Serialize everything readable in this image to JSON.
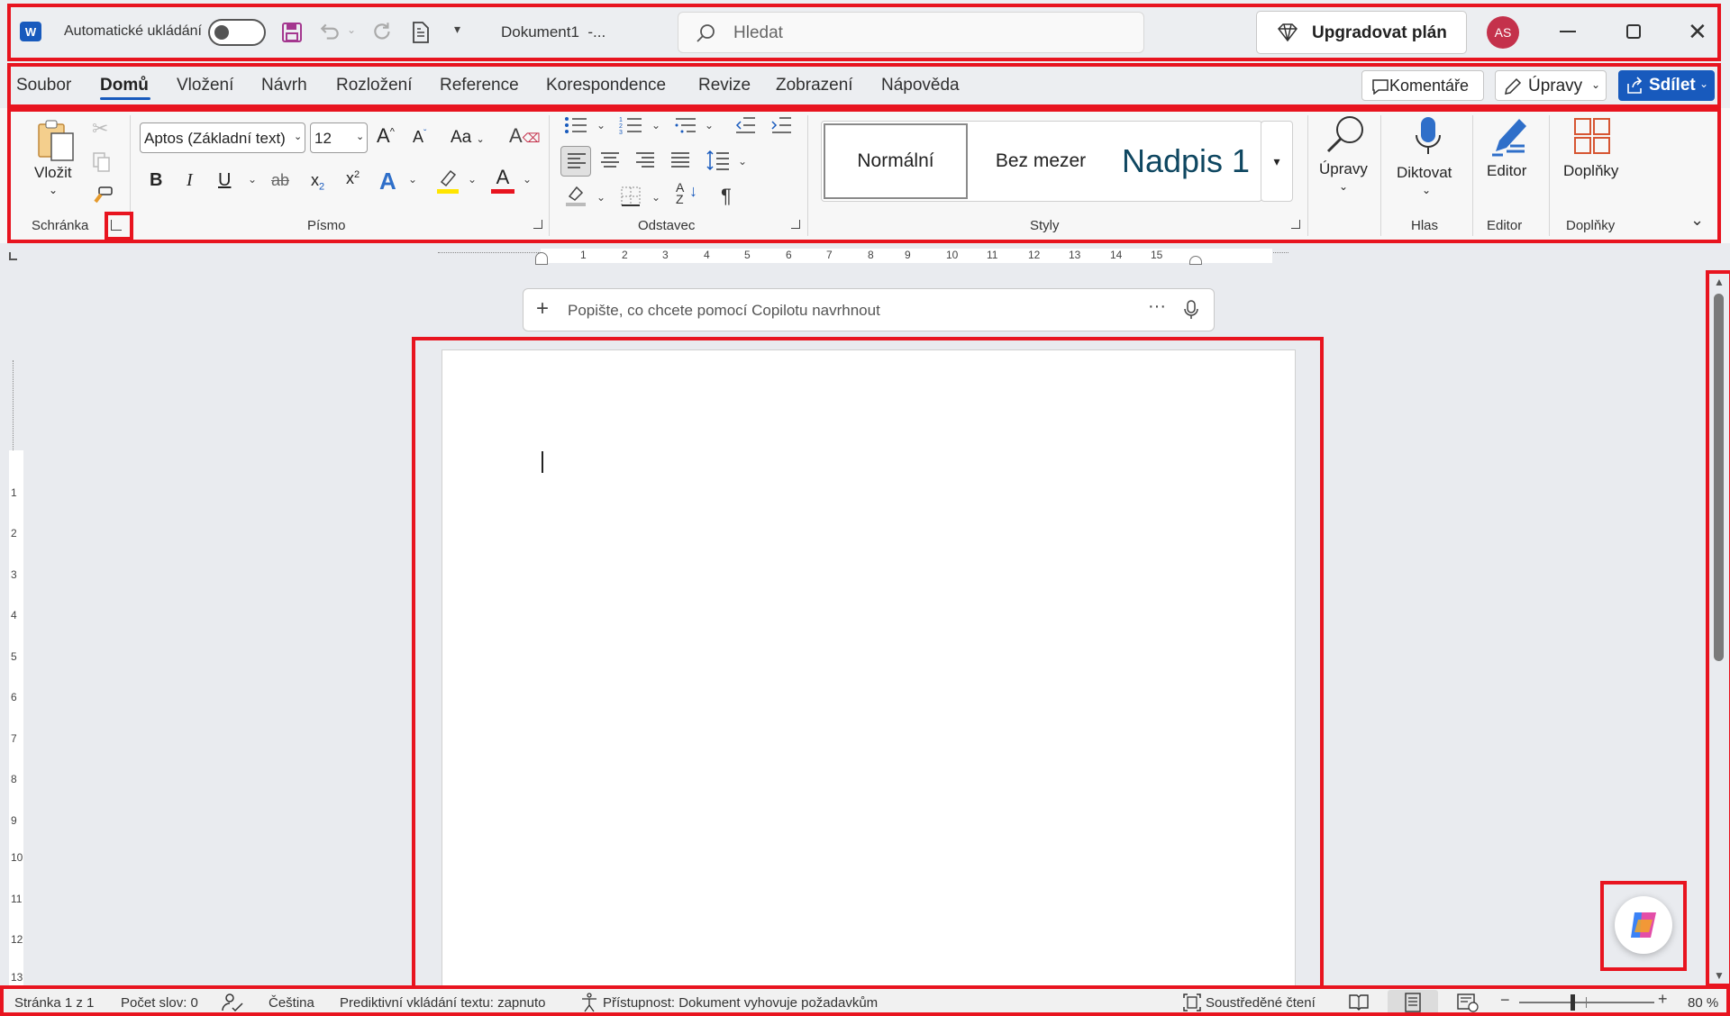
{
  "titlebar": {
    "autosave_label": "Automatické ukládání",
    "doc_name": "Dokument1  -...",
    "search_placeholder": "Hledat",
    "upgrade_label": "Upgradovat plán",
    "avatar_initials": "AS"
  },
  "tabs": [
    "Soubor",
    "Domů",
    "Vložení",
    "Návrh",
    "Rozložení",
    "Reference",
    "Korespondence",
    "Revize",
    "Zobrazení",
    "Nápověda"
  ],
  "tabbar_actions": {
    "comments": "Komentáře",
    "editing": "Úpravy",
    "share": "Sdílet"
  },
  "ribbon": {
    "paste_label": "Vložit",
    "font_name": "Aptos (Základní text)",
    "font_size": "12",
    "case_label": "Aa",
    "styles": [
      "Normální",
      "Bez mezer",
      "Nadpis 1"
    ],
    "editing_label": "Úpravy",
    "dictate_label": "Diktovat",
    "editor_label": "Editor",
    "addins_label": "Doplňky",
    "groups": {
      "clipboard": "Schránka",
      "font": "Písmo",
      "paragraph": "Odstavec",
      "styles": "Styly",
      "voice": "Hlas",
      "editor": "Editor",
      "addins": "Doplňky"
    }
  },
  "ruler_numbers": [
    "1",
    "2",
    "3",
    "4",
    "5",
    "6",
    "7",
    "8",
    "9",
    "10",
    "11",
    "12",
    "13",
    "14",
    "15"
  ],
  "vruler_numbers": [
    "1",
    "2",
    "3",
    "4",
    "5",
    "6",
    "7",
    "8",
    "9",
    "10",
    "11",
    "12",
    "13"
  ],
  "copilot": {
    "placeholder": "Popište, co chcete pomocí Copilotu navrhnout"
  },
  "status": {
    "page": "Stránka 1 z 1",
    "words": "Počet slov: 0",
    "language": "Čeština",
    "predictive": "Prediktivní vkládání textu: zapnuto",
    "accessibility": "Přístupnost: Dokument vyhovuje požadavkům",
    "focus": "Soustředěné čtení",
    "zoom": "80 %"
  },
  "colors": {
    "accent": "#185abd",
    "highlight_box": "#e8141f",
    "avatar": "#c4314b"
  }
}
